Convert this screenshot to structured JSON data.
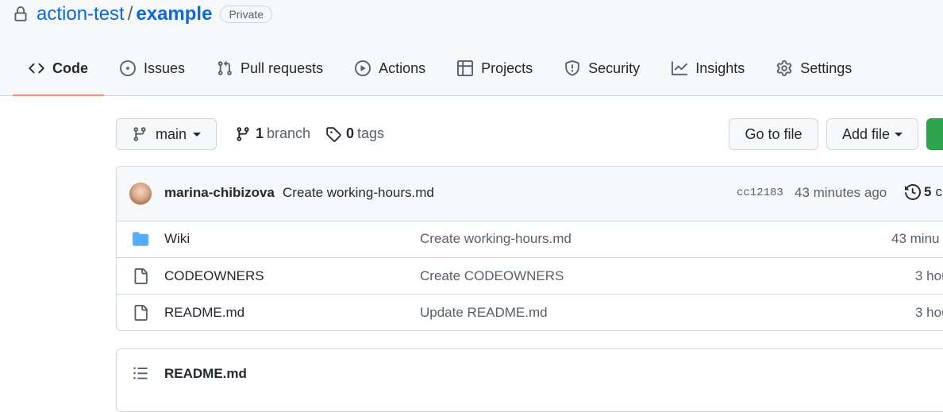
{
  "repo": {
    "owner": "action-test",
    "separator": "/",
    "name": "example",
    "visibility": "Private"
  },
  "tabs": [
    {
      "label": "Code",
      "icon": "code-icon",
      "active": true
    },
    {
      "label": "Issues",
      "icon": "issue-opened-icon"
    },
    {
      "label": "Pull requests",
      "icon": "git-pull-request-icon"
    },
    {
      "label": "Actions",
      "icon": "play-icon"
    },
    {
      "label": "Projects",
      "icon": "table-icon"
    },
    {
      "label": "Security",
      "icon": "shield-icon"
    },
    {
      "label": "Insights",
      "icon": "graph-icon"
    },
    {
      "label": "Settings",
      "icon": "gear-icon"
    }
  ],
  "toolbar": {
    "branch": "main",
    "branch_count": "1",
    "branch_label": "branch",
    "tag_count": "0",
    "tag_label": "tags",
    "go_to_file": "Go to file",
    "add_file": "Add file"
  },
  "latest_commit": {
    "author": "marina-chibizova",
    "message": "Create working-hours.md",
    "sha": "cc12183",
    "time": "43 minutes ago",
    "commits_count": "5",
    "commits_label": "c"
  },
  "files": [
    {
      "name": "Wiki",
      "type": "folder",
      "message": "Create working-hours.md",
      "time": "43 minu"
    },
    {
      "name": "CODEOWNERS",
      "type": "file",
      "message": "Create CODEOWNERS",
      "time": "3 hou"
    },
    {
      "name": "README.md",
      "type": "file",
      "message": "Update README.md",
      "time": "3 hou"
    }
  ],
  "readme": {
    "title": "README.md"
  },
  "colors": {
    "link": "#0969da",
    "accent_underline": "#fd8c73",
    "folder": "#54aeff",
    "primary_button": "#2da44e"
  }
}
